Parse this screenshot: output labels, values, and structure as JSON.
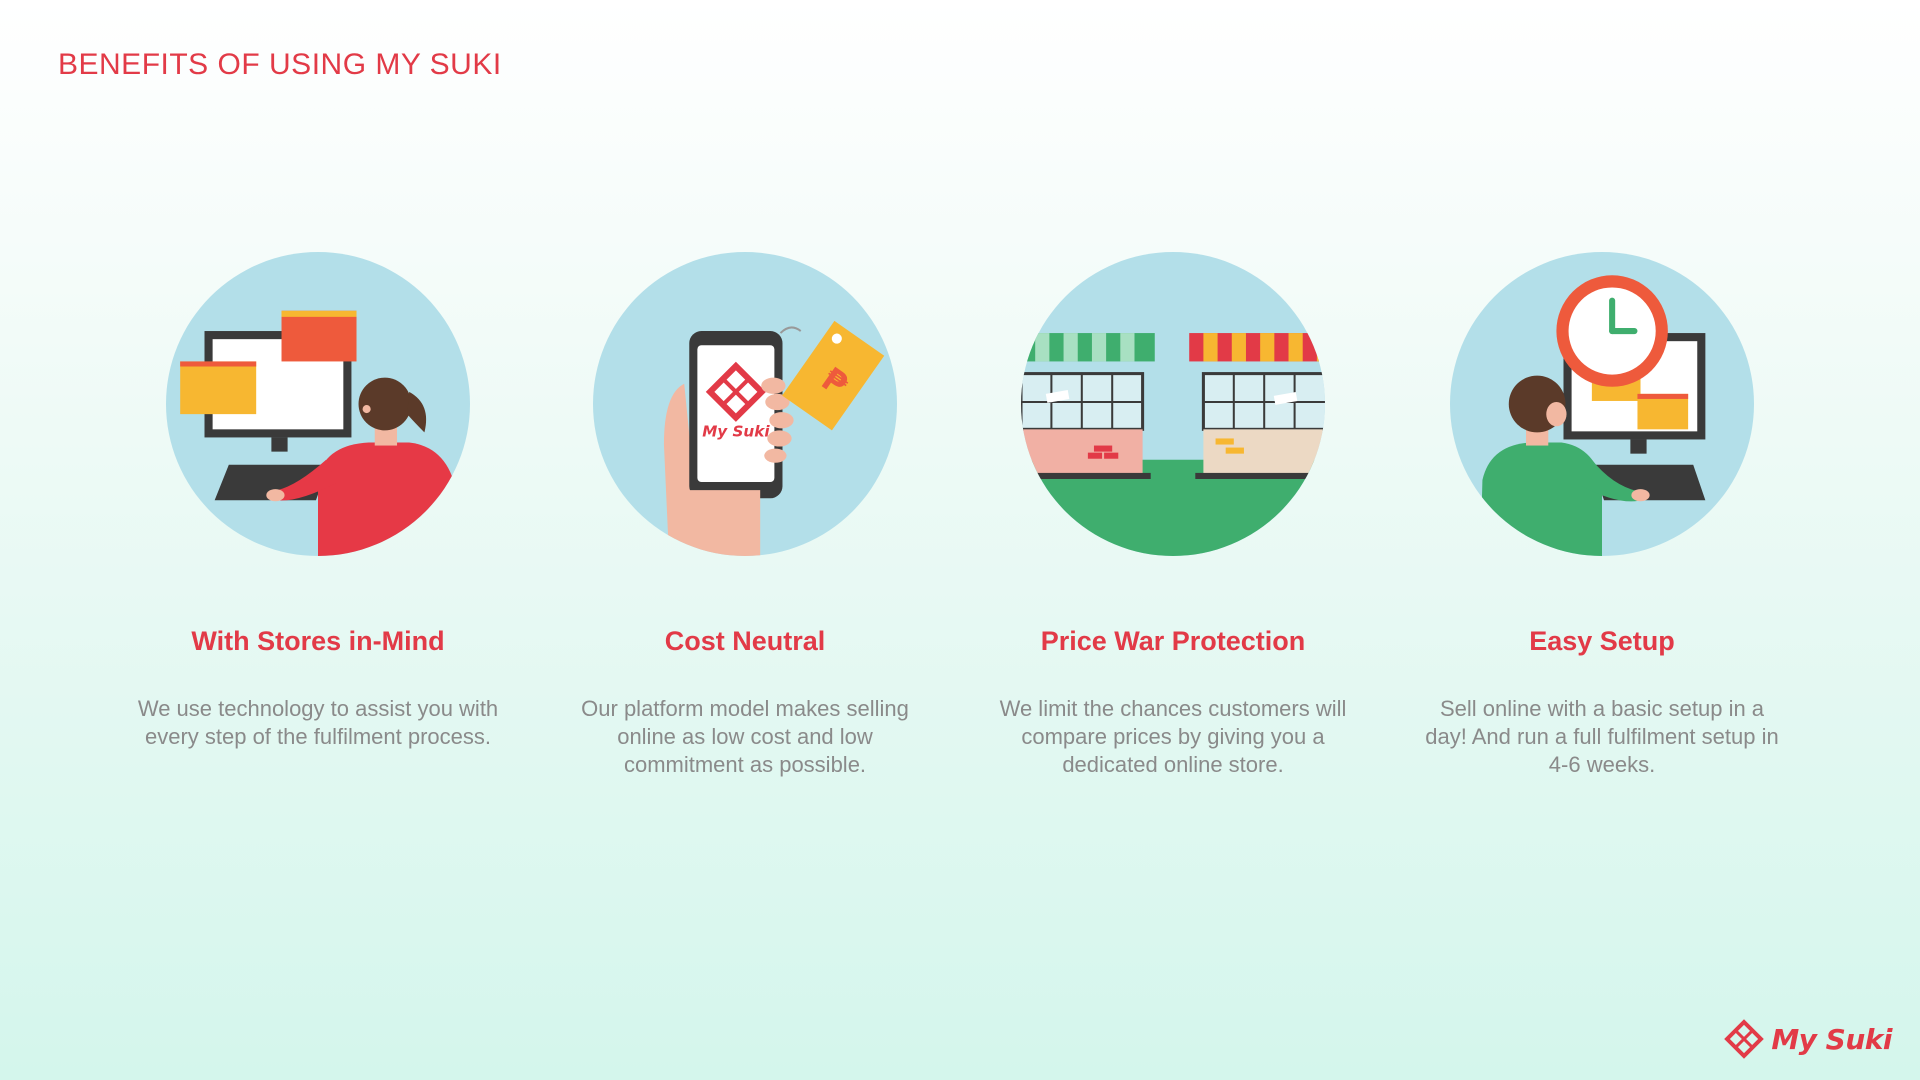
{
  "page": {
    "title": "BENEFITS OF USING MY SUKI"
  },
  "benefits": [
    {
      "title": "With Stores in-Mind",
      "description": "We use technology to assist you with every step of the fulfilment process.",
      "icon": "store-owner-computer-icon"
    },
    {
      "title": "Cost Neutral",
      "description": "Our platform model makes selling online as low cost and low commitment as possible.",
      "icon": "phone-price-tag-icon"
    },
    {
      "title": "Price War Protection",
      "description": "We limit the chances customers will compare prices by giving you a dedicated online store.",
      "icon": "storefronts-icon"
    },
    {
      "title": "Easy Setup",
      "description": "Sell online with a basic setup in a day! And run a full fulfilment setup in 4-6 weeks.",
      "icon": "clock-computer-icon"
    }
  ],
  "phone_screen": {
    "logo_text": "My Suki"
  },
  "price_tag": {
    "symbol": "₱"
  },
  "brand": {
    "logo_text": "My Suki",
    "accent": "#e23a47",
    "circle_bg": "#b3dfe9"
  }
}
